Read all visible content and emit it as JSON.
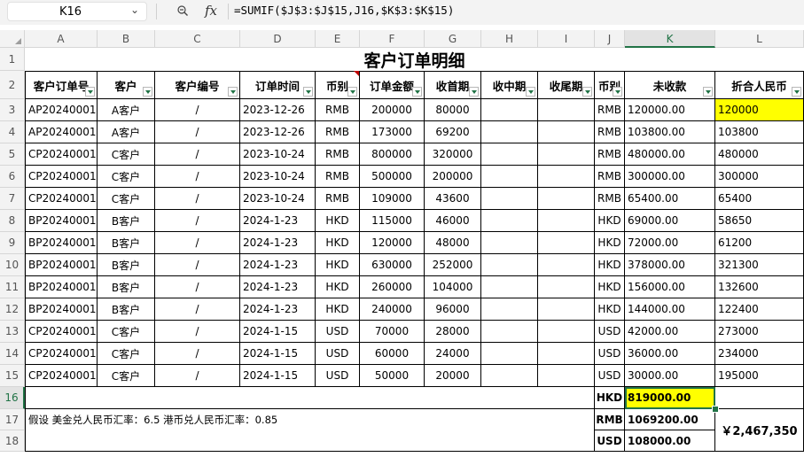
{
  "formula_bar": {
    "cell_ref": "K16",
    "zoom_icon": "zoom-icon",
    "fx_label": "fx",
    "formula": "=SUMIF($J$3:$J$15,J16,$K$3:$K$15)"
  },
  "columns": [
    "A",
    "B",
    "C",
    "D",
    "E",
    "F",
    "G",
    "H",
    "I",
    "J",
    "K",
    "L"
  ],
  "rows": [
    "1",
    "2",
    "3",
    "4",
    "5",
    "6",
    "7",
    "8",
    "9",
    "10",
    "11",
    "12",
    "13",
    "14",
    "15",
    "16",
    "17",
    "18"
  ],
  "title": "客户订单明细",
  "headers": [
    "客户订单号",
    "客户",
    "客户编号",
    "订单时间",
    "币别",
    "订单金额",
    "收首期",
    "收中期",
    "收尾期",
    "币别",
    "未收款",
    "折合人民币"
  ],
  "data_rows": [
    [
      "AP20240001",
      "A客户",
      "/",
      "2023-12-26",
      "RMB",
      "200000",
      "80000",
      "",
      "",
      "RMB",
      "120000.00",
      "120000"
    ],
    [
      "AP20240001",
      "A客户",
      "/",
      "2023-12-26",
      "RMB",
      "173000",
      "69200",
      "",
      "",
      "RMB",
      "103800.00",
      "103800"
    ],
    [
      "CP20240001",
      "C客户",
      "/",
      "2023-10-24",
      "RMB",
      "800000",
      "320000",
      "",
      "",
      "RMB",
      "480000.00",
      "480000"
    ],
    [
      "CP20240001",
      "C客户",
      "/",
      "2023-10-24",
      "RMB",
      "500000",
      "200000",
      "",
      "",
      "RMB",
      "300000.00",
      "300000"
    ],
    [
      "CP20240001",
      "C客户",
      "/",
      "2023-10-24",
      "RMB",
      "109000",
      "43600",
      "",
      "",
      "RMB",
      "65400.00",
      "65400"
    ],
    [
      "BP20240001",
      "B客户",
      "/",
      "2024-1-23",
      "HKD",
      "115000",
      "46000",
      "",
      "",
      "HKD",
      "69000.00",
      "58650"
    ],
    [
      "BP20240001",
      "B客户",
      "/",
      "2024-1-23",
      "HKD",
      "120000",
      "48000",
      "",
      "",
      "HKD",
      "72000.00",
      "61200"
    ],
    [
      "BP20240001",
      "B客户",
      "/",
      "2024-1-23",
      "HKD",
      "630000",
      "252000",
      "",
      "",
      "HKD",
      "378000.00",
      "321300"
    ],
    [
      "BP20240001",
      "B客户",
      "/",
      "2024-1-23",
      "HKD",
      "260000",
      "104000",
      "",
      "",
      "HKD",
      "156000.00",
      "132600"
    ],
    [
      "BP20240001",
      "B客户",
      "/",
      "2024-1-23",
      "HKD",
      "240000",
      "96000",
      "",
      "",
      "HKD",
      "144000.00",
      "122400"
    ],
    [
      "CP20240001",
      "C客户",
      "/",
      "2024-1-15",
      "USD",
      "70000",
      "28000",
      "",
      "",
      "USD",
      "42000.00",
      "273000"
    ],
    [
      "CP20240001",
      "C客户",
      "/",
      "2024-1-15",
      "USD",
      "60000",
      "24000",
      "",
      "",
      "USD",
      "36000.00",
      "234000"
    ],
    [
      "CP20240001",
      "C客户",
      "/",
      "2024-1-15",
      "USD",
      "50000",
      "20000",
      "",
      "",
      "USD",
      "30000.00",
      "195000"
    ]
  ],
  "summary": [
    {
      "currency": "HKD",
      "amount": "819000.00"
    },
    {
      "currency": "RMB",
      "amount": "1069200.00"
    },
    {
      "currency": "USD",
      "amount": "108000.00"
    }
  ],
  "note": "假设 美金兑人民币汇率：6.5  港币兑人民币汇率：0.85",
  "grand_total": "￥2,467,350",
  "colors": {
    "highlight": "#ffff00",
    "accent": "#217346",
    "header_bg": "#f3f3f3"
  }
}
